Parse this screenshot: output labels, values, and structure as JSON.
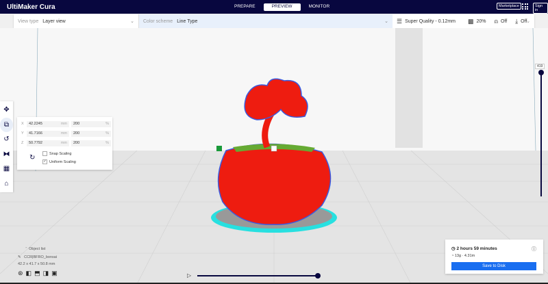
{
  "app": {
    "title": "UltiMaker Cura"
  },
  "stages": [
    {
      "label": "PREPARE"
    },
    {
      "label": "PREVIEW"
    },
    {
      "label": "MONITOR"
    }
  ],
  "topright": {
    "marketplace": "Marketplace",
    "signin": "Sign in"
  },
  "header": {
    "view_type_label": "View type",
    "view_type_value": "Layer view",
    "color_scheme_label": "Color scheme",
    "color_scheme_value": "Line Type",
    "profile": "Super Quality - 0.12mm",
    "infill": "20%",
    "support": "Off",
    "adhesion": "Off"
  },
  "scale": {
    "x": "42.2245",
    "y": "41.7166",
    "z": "50.7792",
    "unit": "mm",
    "px": "200",
    "py": "200",
    "pz": "200",
    "pct": "%",
    "snap": "Snap Scaling",
    "uniform": "Uniform Scaling",
    "snap_checked": false,
    "uniform_checked": true
  },
  "object": {
    "list_label": "Object list",
    "name": "CCR|BFRO_bonsai",
    "dims": "42.2 x 41.7 x 50.8 mm"
  },
  "layer": {
    "current": "419",
    "fraction": 1.0
  },
  "print": {
    "time": "2 hours 59 minutes",
    "material": "13g · 4.31m",
    "save": "Save to Disk"
  },
  "colors": {
    "accent": "#196ef0",
    "nav": "#08073f",
    "model": "#ee1c10"
  }
}
